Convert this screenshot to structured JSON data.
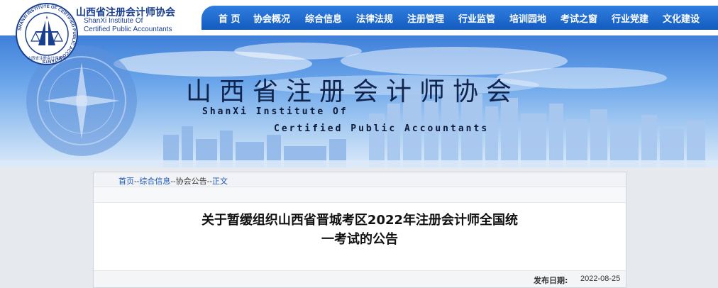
{
  "header": {
    "org_name_cn": "山西省注册会计师协会",
    "org_name_en_line1": "ShanXi Institute Of",
    "org_name_en_line2": "Certified Public Accountants",
    "logo_ring_text": "SHANXI INSTITUTE OF CERTIFIED PUBLIC ACCOUNTANTS",
    "logo_bottom_text": "山西省注册会计师协会"
  },
  "nav": {
    "items": [
      {
        "label": "首 页"
      },
      {
        "label": "协会概况"
      },
      {
        "label": "综合信息"
      },
      {
        "label": "法律法规"
      },
      {
        "label": "注册管理"
      },
      {
        "label": "行业监管"
      },
      {
        "label": "培训园地"
      },
      {
        "label": "考试之窗"
      },
      {
        "label": "行业党建"
      },
      {
        "label": "文化建设"
      }
    ]
  },
  "banner": {
    "title": "山西省注册会计师协会",
    "subtitle_line1": "ShanXi Institute Of",
    "subtitle_line2": "Certified Public Accountants"
  },
  "breadcrumb": {
    "home": "首页",
    "section": "综合信息",
    "subsection": "协会公告",
    "current": "正文",
    "separator": "--"
  },
  "article": {
    "title_line1": "关于暂缓组织山西省晋城考区2022年注册会计师全国统",
    "title_line2": "一考试的公告",
    "date_label": "发布日期:",
    "date_value": "2022-08-25"
  },
  "colors": {
    "nav_bg": "#145bbf",
    "brand_text": "#1a3f8f",
    "link": "#1b56b5",
    "page_bg": "#e6e9ee"
  }
}
